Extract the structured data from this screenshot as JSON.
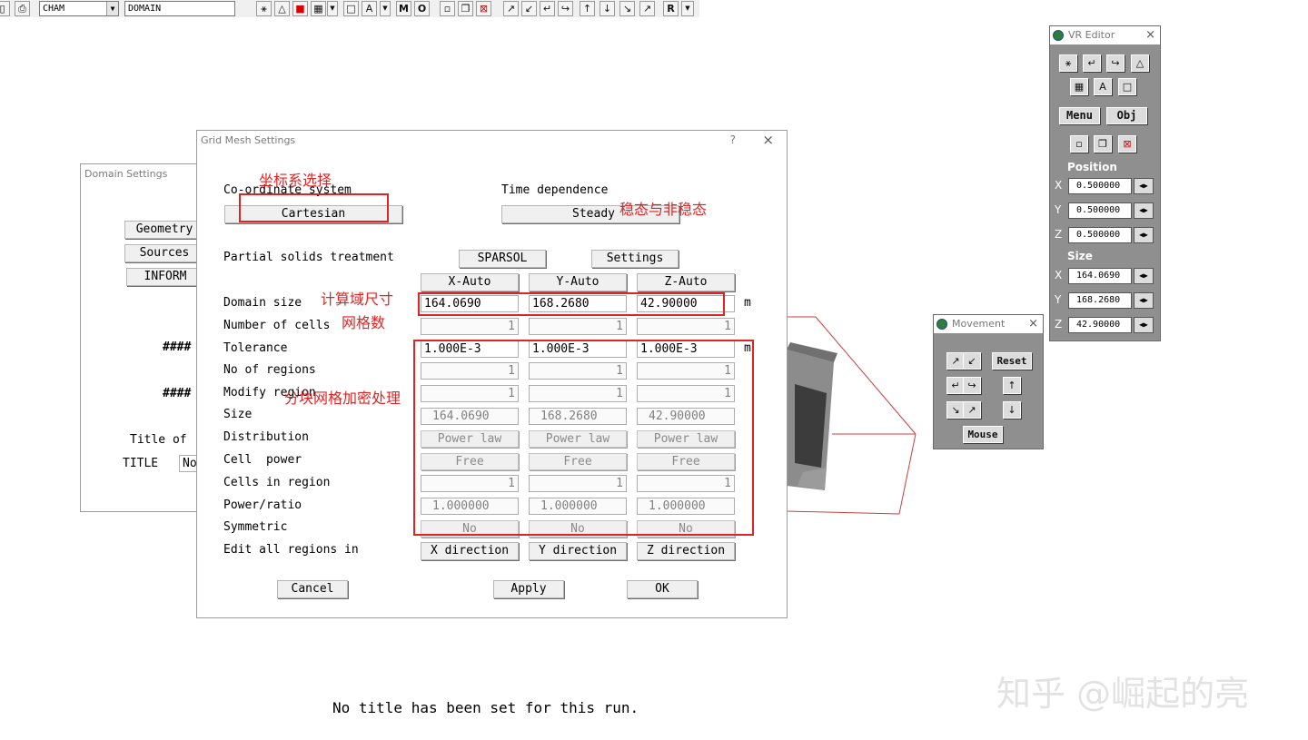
{
  "toolbar": {
    "combo_1": "CHAM",
    "combo_2": "DOMAIN",
    "r_button": "R",
    "icons": [
      "printer-icon",
      "view-icon",
      "triangle-icon",
      "red-square-icon",
      "grid-icon",
      "box-icon",
      "font-icon",
      "m-icon",
      "o-icon",
      "cell-icon",
      "copy-icon",
      "delete-icon",
      "arrow-ne-icon",
      "arrow-sw-icon",
      "turn-left-icon",
      "turn-right-icon",
      "up-icon",
      "down-icon",
      "diag-in-icon",
      "diag-out-icon"
    ]
  },
  "domain_settings": {
    "title": "Domain Settings",
    "buttons": [
      "Geometry",
      "Sources",
      "INFORM"
    ],
    "hash_1": "####",
    "hash_2": "####",
    "title_of": "Title of",
    "title_label": "TITLE",
    "title_value": "No"
  },
  "grid_mesh": {
    "title": "Grid Mesh Settings",
    "help": "?",
    "close": "×",
    "coord_label": "Co-ordinate system",
    "coord_value": "Cartesian",
    "time_label": "Time dependence",
    "time_value": "Steady",
    "partial_label": "Partial solids treatment",
    "sparsol": "SPARSOL",
    "settings": "Settings",
    "col_headers": [
      "X-Auto",
      "Y-Auto",
      "Z-Auto"
    ],
    "unit_m": "m",
    "rows": [
      {
        "label": "Domain size",
        "values": [
          "164.0690",
          "168.2680",
          "42.90000"
        ]
      },
      {
        "label": "Number of cells",
        "values": [
          "1",
          "1",
          "1"
        ]
      },
      {
        "label": "Tolerance",
        "values": [
          "1.000E-3",
          "1.000E-3",
          "1.000E-3"
        ]
      },
      {
        "label": "No of regions",
        "values": [
          "1",
          "1",
          "1"
        ]
      },
      {
        "label": "Modify region",
        "values": [
          "1",
          "1",
          "1"
        ]
      },
      {
        "label": "Size",
        "values": [
          "164.0690",
          "168.2680",
          "42.90000"
        ]
      },
      {
        "label": "Distribution",
        "values": [
          "Power law",
          "Power law",
          "Power law"
        ]
      },
      {
        "label": "Cell  power",
        "values": [
          "Free",
          "Free",
          "Free"
        ]
      },
      {
        "label": "Cells in region",
        "values": [
          "1",
          "1",
          "1"
        ]
      },
      {
        "label": "Power/ratio",
        "values": [
          "1.000000",
          "1.000000",
          "1.000000"
        ]
      },
      {
        "label": "Symmetric",
        "values": [
          "No",
          "No",
          "No"
        ]
      }
    ],
    "edit_all_label": "Edit all regions in",
    "direction_buttons": [
      "X direction",
      "Y direction",
      "Z direction"
    ],
    "cancel": "Cancel",
    "apply": "Apply",
    "ok": "OK"
  },
  "annotations": {
    "coord": "坐标系选择",
    "steady": "稳态与非稳态",
    "domain": "计算域尺寸",
    "cells": "网格数",
    "refine": "分块网格加密处理"
  },
  "vr_editor": {
    "title": "VR Editor",
    "menu": "Menu",
    "obj": "Obj",
    "position_label": "Position",
    "size_label": "Size",
    "position": [
      {
        "axis": "X",
        "value": "0.500000"
      },
      {
        "axis": "Y",
        "value": "0.500000"
      },
      {
        "axis": "Z",
        "value": "0.500000"
      }
    ],
    "size": [
      {
        "axis": "X",
        "value": "164.0690"
      },
      {
        "axis": "Y",
        "value": "168.2680"
      },
      {
        "axis": "Z",
        "value": "42.90000"
      }
    ]
  },
  "movement": {
    "title": "Movement",
    "reset": "Reset",
    "mouse": "Mouse"
  },
  "footer": "No title has been set for this run.",
  "watermark": "知乎 @崛起的亮",
  "colors": {
    "annotation_red": "#e02424",
    "panel_gray": "#8f8f8f"
  }
}
